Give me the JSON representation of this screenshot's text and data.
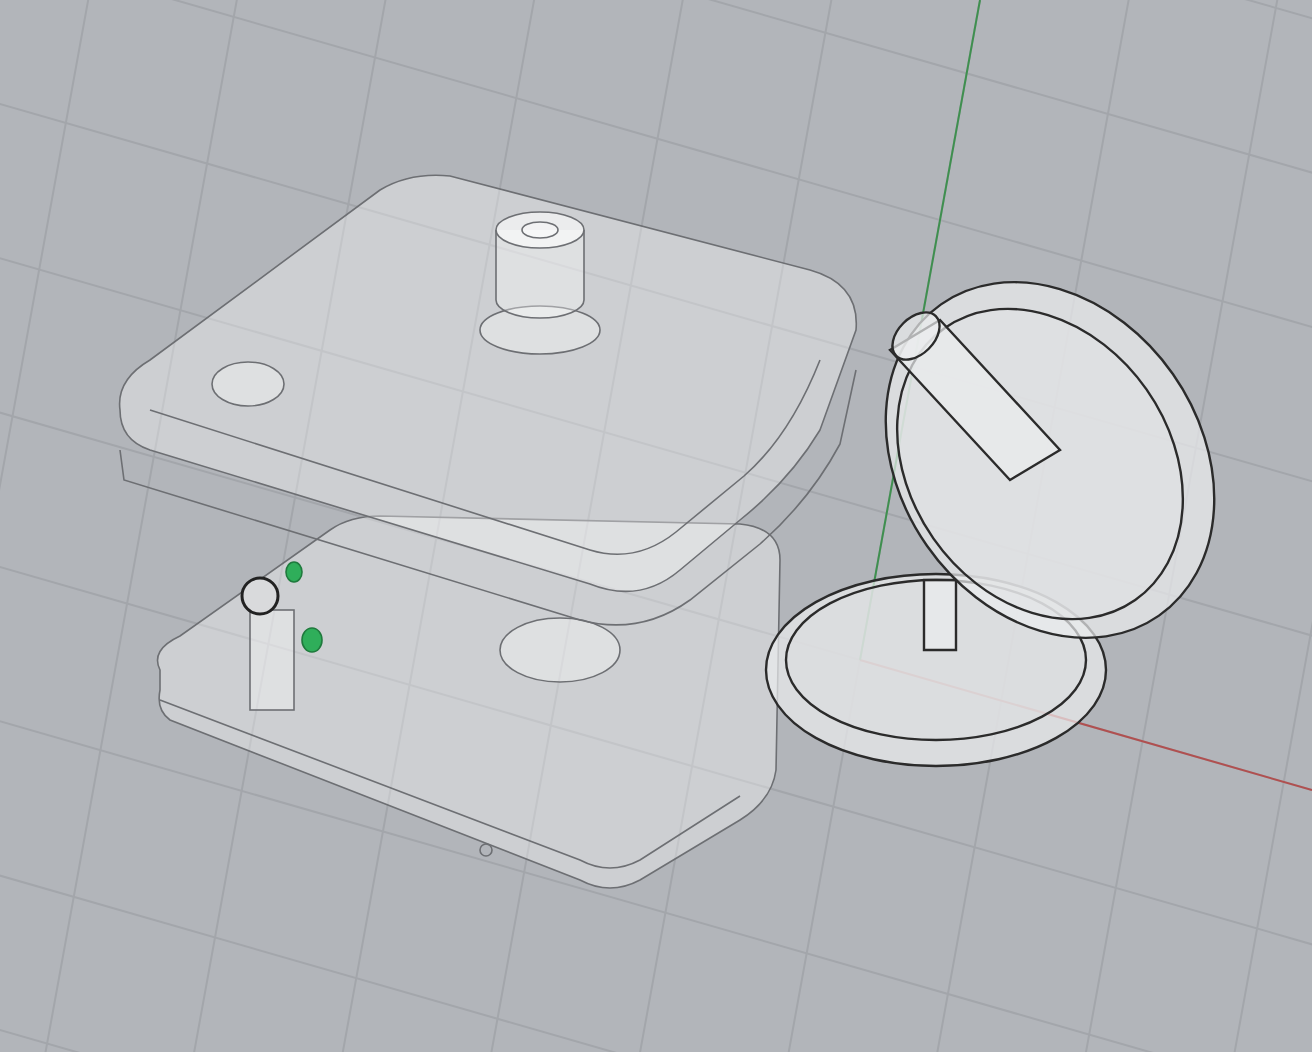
{
  "viewport": {
    "grid_visible": true,
    "axes_visible": true
  }
}
